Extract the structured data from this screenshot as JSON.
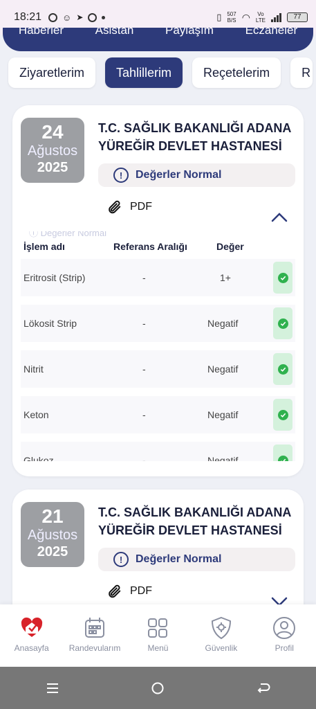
{
  "status_bar": {
    "time": "18:21",
    "network_speed": "507",
    "network_unit": "B/S",
    "lte_top": "Vo",
    "lte_bottom": "LTE",
    "battery": "77"
  },
  "top_tabs": [
    "Haberler",
    "Asistan",
    "Paylaşım",
    "Eczaneler"
  ],
  "chips": [
    {
      "label": "Ziyaretlerim",
      "active": false
    },
    {
      "label": "Tahlillerim",
      "active": true
    },
    {
      "label": "Reçetelerim",
      "active": false
    },
    {
      "label": "R",
      "active": false
    }
  ],
  "cards": [
    {
      "day": "24",
      "month": "Ağustos",
      "year": "2025",
      "hospital": "T.C. SAĞLIK BAKANLIĞI ADANA YÜREĞİR DEVLET HASTANESİ",
      "status": "Değerler Normal",
      "pdf_label": "PDF",
      "expanded": true,
      "ghost_text": "Değerler Normal",
      "table_headers": {
        "name": "İşlem adı",
        "range": "Referans Aralığı",
        "value": "Değer"
      },
      "rows": [
        {
          "name": "Eritrosit (Strip)",
          "range": "-",
          "value": "1+"
        },
        {
          "name": "Lökosit Strip",
          "range": "-",
          "value": "Negatif"
        },
        {
          "name": "Nitrit",
          "range": "-",
          "value": "Negatif"
        },
        {
          "name": "Keton",
          "range": "-",
          "value": "Negatif"
        },
        {
          "name": "Glukoz",
          "range": "-",
          "value": "Negatif"
        }
      ]
    },
    {
      "day": "21",
      "month": "Ağustos",
      "year": "2025",
      "hospital": "T.C. SAĞLIK BAKANLIĞI ADANA YÜREĞİR DEVLET HASTANESİ",
      "status": "Değerler Normal",
      "pdf_label": "PDF",
      "expanded": false
    }
  ],
  "bottom_nav": [
    {
      "label": "Anasayfa",
      "icon": "heart-home-icon",
      "active": true
    },
    {
      "label": "Randevularım",
      "icon": "calendar-icon",
      "active": false
    },
    {
      "label": "Menü",
      "icon": "grid-icon",
      "active": false
    },
    {
      "label": "Güvenlik",
      "icon": "shield-gear-icon",
      "active": false
    },
    {
      "label": "Profil",
      "icon": "profile-icon",
      "active": false
    }
  ],
  "colors": {
    "navy": "#2d3a7a",
    "background": "#eef0f6",
    "success": "#2fb14e",
    "date_box": "#9d9fa3"
  }
}
